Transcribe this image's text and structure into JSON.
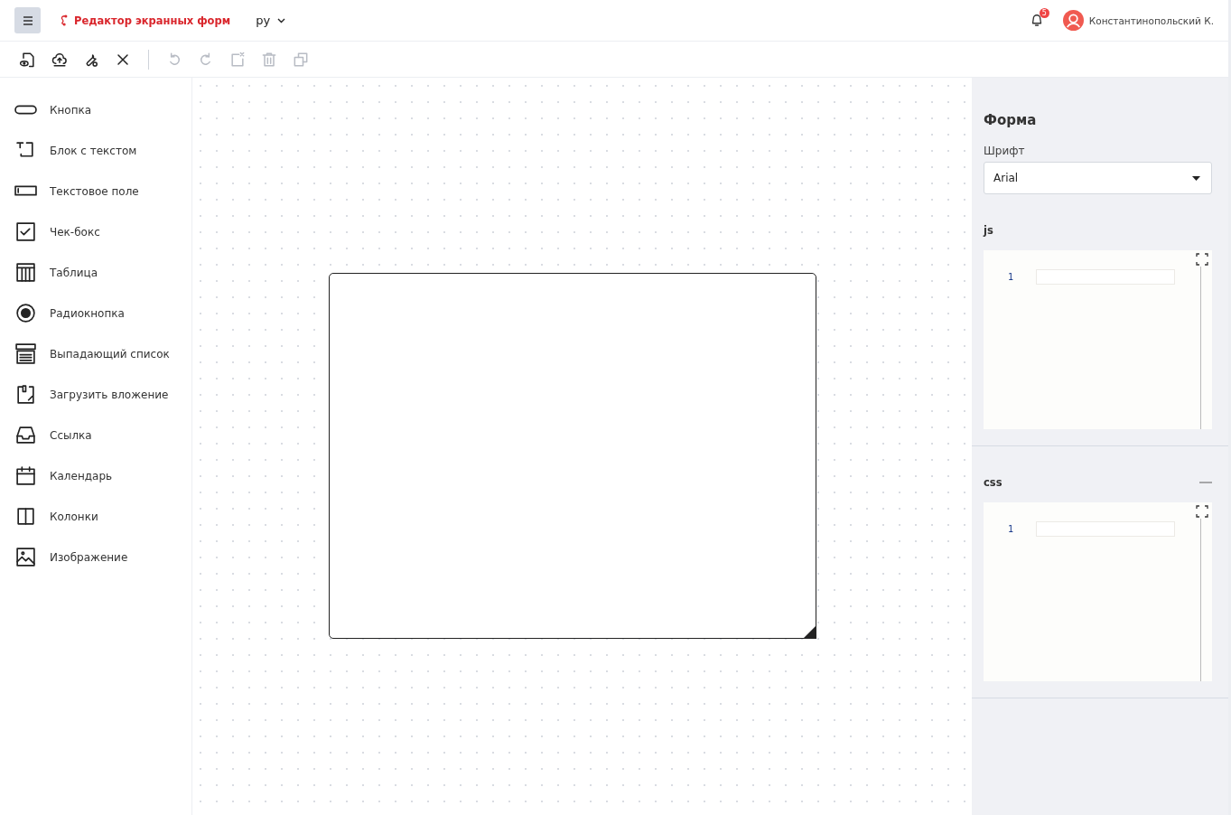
{
  "header": {
    "title": "Редактор экранных форм",
    "language": "ру",
    "notifications": "5",
    "user": "Константинопольский К."
  },
  "toolbar": [
    {
      "kind": "preview",
      "disabled": false
    },
    {
      "kind": "upload",
      "disabled": false
    },
    {
      "kind": "tools",
      "disabled": false
    },
    {
      "kind": "close",
      "disabled": false
    },
    {
      "kind": "undo",
      "disabled": true
    },
    {
      "kind": "redo",
      "disabled": true
    },
    {
      "kind": "cut",
      "disabled": true
    },
    {
      "kind": "delete",
      "disabled": true
    },
    {
      "kind": "copy",
      "disabled": true
    }
  ],
  "components": [
    {
      "kind": "button",
      "label": "Кнопка"
    },
    {
      "kind": "text",
      "label": "Блок с текстом"
    },
    {
      "kind": "input",
      "label": "Текстовое поле"
    },
    {
      "kind": "checkbox",
      "label": "Чек-бокс"
    },
    {
      "kind": "table",
      "label": "Таблица"
    },
    {
      "kind": "radio",
      "label": "Радиокнопка"
    },
    {
      "kind": "select",
      "label": "Выпадающий список"
    },
    {
      "kind": "attach",
      "label": "Загрузить вложение"
    },
    {
      "kind": "link",
      "label": "Ссылка"
    },
    {
      "kind": "calendar",
      "label": "Календарь"
    },
    {
      "kind": "columns",
      "label": "Колонки"
    },
    {
      "kind": "image",
      "label": "Изображение"
    }
  ],
  "properties": {
    "title": "Форма",
    "font_label": "Шрифт",
    "font_value": "Arial",
    "editors": [
      {
        "label": "js",
        "line": "1",
        "collapsible": false
      },
      {
        "label": "css",
        "line": "1",
        "collapsible": true
      }
    ]
  }
}
